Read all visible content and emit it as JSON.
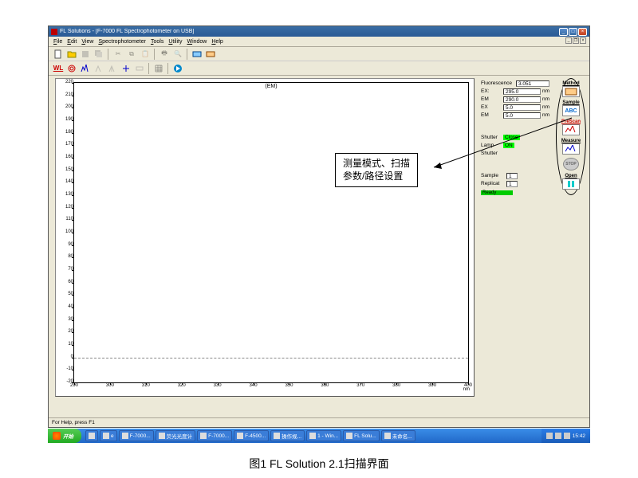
{
  "window": {
    "title": "FL Solutions - [F-7000 FL Spectrophotometer on USB]"
  },
  "menu": {
    "file": "File",
    "edit": "Edit",
    "view": "View",
    "spectro": "Spectrophotometer",
    "tools": "Tools",
    "utility": "Utility",
    "window": "Window",
    "help": "Help"
  },
  "chart_data": {
    "type": "line",
    "title": "(EM)",
    "series": [],
    "x": {
      "label": "nm",
      "min": 290,
      "max": 400,
      "ticks": [
        290,
        300,
        310,
        320,
        330,
        340,
        350,
        360,
        370,
        380,
        390,
        400
      ]
    },
    "y": {
      "min": -20,
      "max": 220,
      "ticks": [
        -20,
        -10,
        0,
        10,
        20,
        30,
        40,
        50,
        60,
        70,
        80,
        90,
        100,
        110,
        120,
        130,
        140,
        150,
        160,
        170,
        180,
        190,
        200,
        210,
        220
      ],
      "baseline": 0
    }
  },
  "side": {
    "fluor_label": "Fluorescence",
    "fluor_val": "3.051",
    "ex_label": "EX:",
    "ex_val": "295.0",
    "ex_unit": "nm",
    "em_label": "EM",
    "em_val": "290.0",
    "em_unit": "nm",
    "ex2_label": "EX",
    "ex2_val": "5.0",
    "ex2_unit": "nm",
    "em2_label": "EM",
    "em2_val": "5.0",
    "em2_unit": "nm",
    "shutter_label": "Shutter",
    "shutter_val": "Close",
    "lamp_label": "Lamp",
    "lamp_val": "ON",
    "shutter2": "Shutter",
    "sample_label": "Sample",
    "sample_val": "1",
    "replicat_label": "Replicat",
    "replicat_val": "1",
    "ready": "Ready"
  },
  "buttons": {
    "method": "Method",
    "sample": "Sample",
    "prescan": "PreScan",
    "measure": "Measure",
    "stop": "STOP",
    "open": "Open"
  },
  "statusbar": "For Help, press F1",
  "taskbar": {
    "start": "开始",
    "items": [
      "e",
      "F-7000...",
      "荧光光度计",
      "F-7000...",
      "F-4500...",
      "操作规...",
      "1 - Win...",
      "FL Solu...",
      "未命名..."
    ],
    "clock": "15:42"
  },
  "callout": {
    "line1": "测量模式、扫描",
    "line2": "参数/路径设置"
  },
  "caption": "图1   FL Solution 2.1扫描界面"
}
